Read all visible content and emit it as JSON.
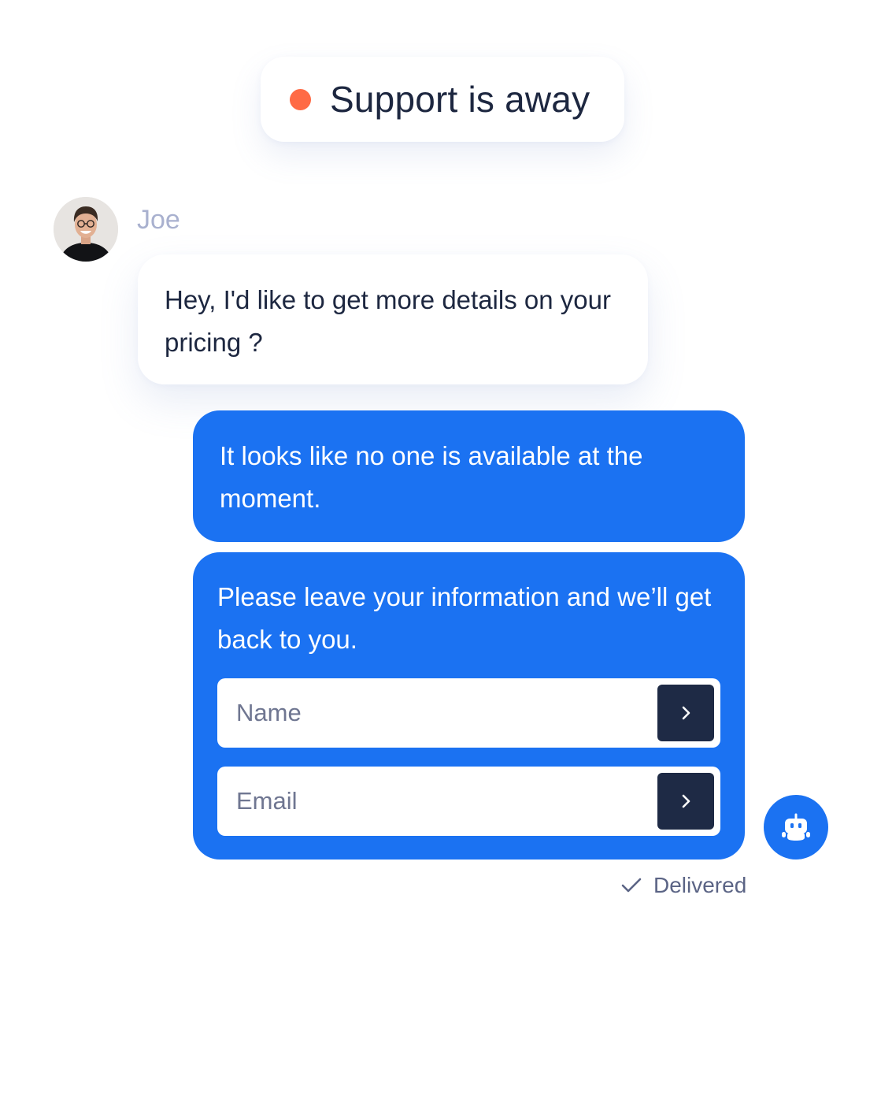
{
  "status": {
    "text": "Support is away",
    "dot_color": "#ff6a45",
    "dot_icon": "status-dot-icon"
  },
  "conversation": {
    "author": {
      "name": "Joe",
      "avatar_icon": "user-avatar"
    },
    "visitor_message": "Hey, I'd like to get more details on your pricing ?",
    "bot_message": "It looks like no one is available at the moment.",
    "form": {
      "prompt": "Please leave your information and we’ll get back to you.",
      "name_placeholder": "Name",
      "email_placeholder": "Email",
      "submit_icon": "chevron-right-icon"
    },
    "bot_badge_icon": "robot-icon",
    "delivery": {
      "text": "Delivered",
      "icon": "check-icon"
    }
  },
  "colors": {
    "accent": "#1b72f2",
    "dark_button": "#1e2a45",
    "text_primary": "#1d2740",
    "text_muted": "#a9b1cf",
    "away_status": "#ff6a45"
  }
}
